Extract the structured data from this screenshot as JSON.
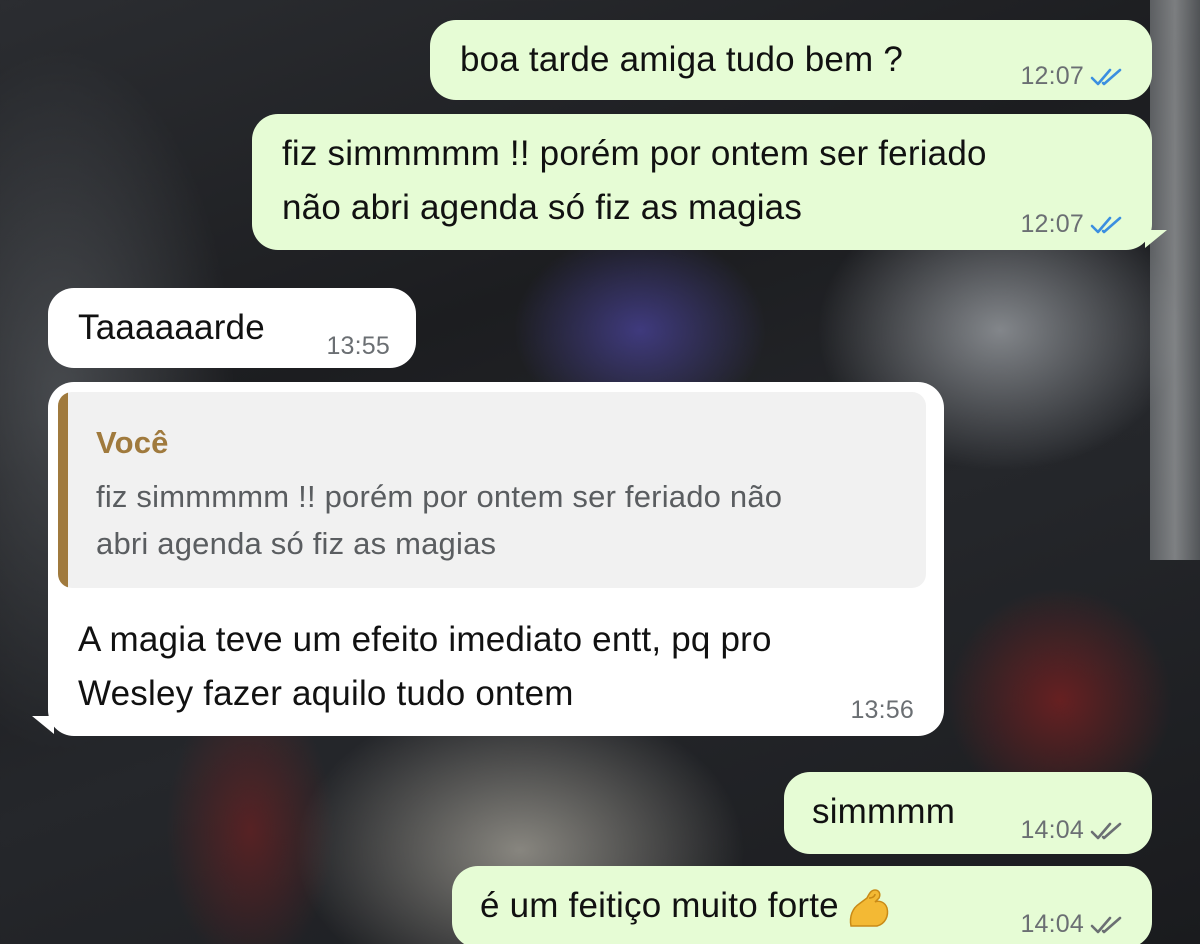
{
  "chat": {
    "messages": [
      {
        "direction": "outgoing",
        "text": "boa tarde amiga tudo bem ?",
        "time": "12:07",
        "status": "read",
        "tick_color": "#3b8fe0"
      },
      {
        "direction": "outgoing",
        "text_lines": [
          "fiz simmmmm !! porém por ontem ser feriado",
          "não abri agenda só fiz as magias"
        ],
        "time": "12:07",
        "status": "read",
        "tick_color": "#3b8fe0"
      },
      {
        "direction": "incoming",
        "text": "Taaaaaarde",
        "time": "13:55"
      },
      {
        "direction": "incoming",
        "quote": {
          "author": "Você",
          "text_lines": [
            "fiz simmmmm !! porém por ontem ser feriado não",
            "abri agenda só fiz as magias"
          ],
          "accent_color": "#a07a3d"
        },
        "text_lines": [
          "A magia teve um efeito imediato entt, pq pro",
          "Wesley fazer aquilo tudo ontem"
        ],
        "time": "13:56"
      },
      {
        "direction": "outgoing",
        "text": "simmmm",
        "time": "14:04",
        "status": "delivered",
        "tick_color": "#6b6f73"
      },
      {
        "direction": "outgoing",
        "text": "é um feitiço muito forte",
        "emoji": "flexed-biceps",
        "time": "14:04",
        "status": "delivered",
        "tick_color": "#6b6f73"
      }
    ]
  },
  "colors": {
    "outgoing_bubble": "#e6fcd5",
    "incoming_bubble": "#ffffff",
    "read_ticks": "#3b8fe0",
    "delivered_ticks": "#6b6f73",
    "quote_accent": "#a07a3d"
  }
}
